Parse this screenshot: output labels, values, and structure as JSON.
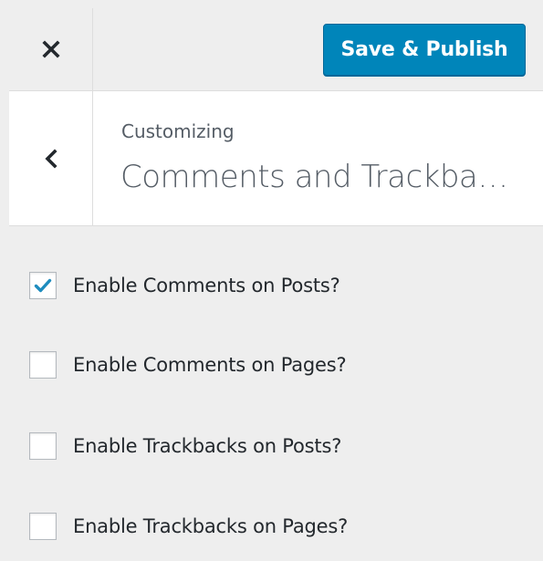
{
  "header": {
    "close_icon": "close-icon",
    "publish_label": "Save & Publish",
    "publish_color": "#0085ba"
  },
  "section": {
    "back_icon": "chevron-left-icon",
    "customizing_label": "Customizing",
    "title": "Comments and Trackbacks"
  },
  "controls": [
    {
      "label": "Enable Comments on Posts?",
      "checked": true
    },
    {
      "label": "Enable Comments on Pages?",
      "checked": false
    },
    {
      "label": "Enable Trackbacks on Posts?",
      "checked": false
    },
    {
      "label": "Enable Trackbacks on Pages?",
      "checked": false
    }
  ],
  "colors": {
    "check_mark": "#1e8cbe",
    "panel_bg": "#eeeeee",
    "text": "#23282d"
  }
}
